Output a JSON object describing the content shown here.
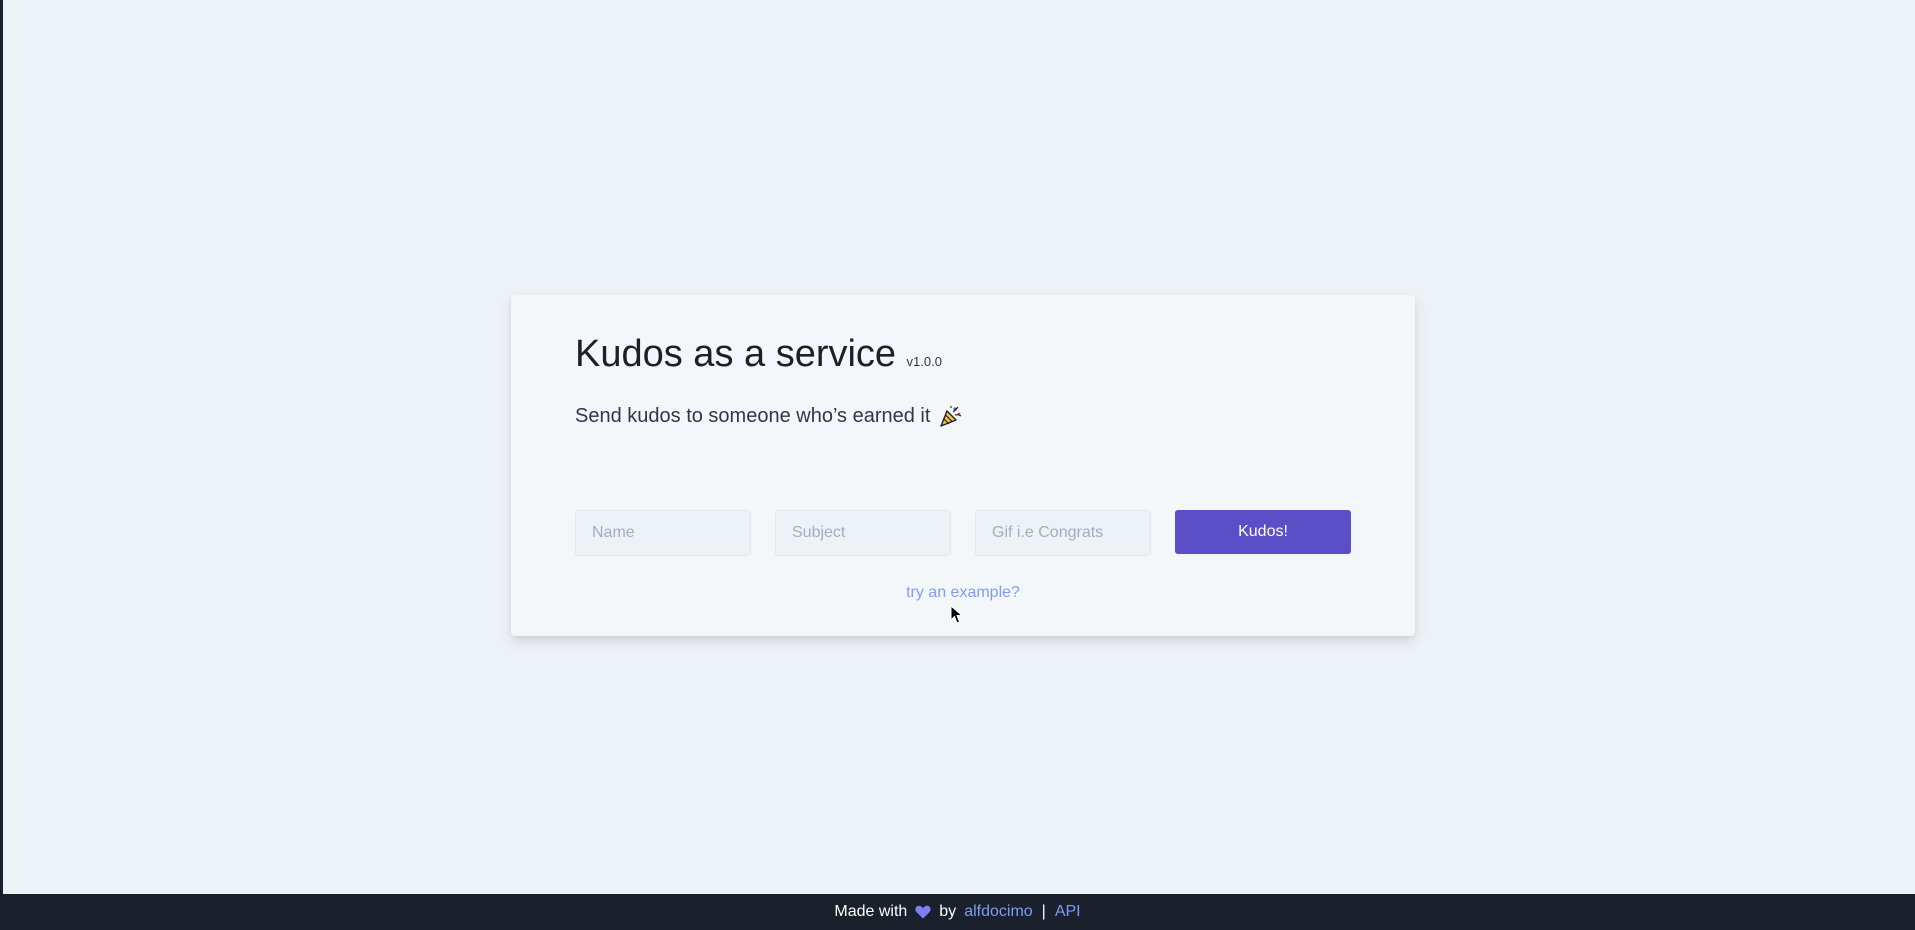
{
  "card": {
    "title": "Kudos as a service",
    "version": "v1.0.0",
    "subtitle": "Send kudos to someone who’s earned it",
    "subtitle_icon": "party-popper-icon"
  },
  "form": {
    "name_placeholder": "Name",
    "subject_placeholder": "Subject",
    "gif_placeholder": "Gif i.e Congrats",
    "submit_label": "Kudos!",
    "example_link": "try an example?"
  },
  "footer": {
    "made_with": "Made with",
    "heart_icon": "heart-icon",
    "by": "by",
    "author": "alfdocimo",
    "separator": "|",
    "api": "API"
  },
  "colors": {
    "background": "#edf2f7",
    "card": "#f4f7fa",
    "accent": "#5a4fc6",
    "link": "#7f9cf5",
    "footer": "#1a202c"
  }
}
